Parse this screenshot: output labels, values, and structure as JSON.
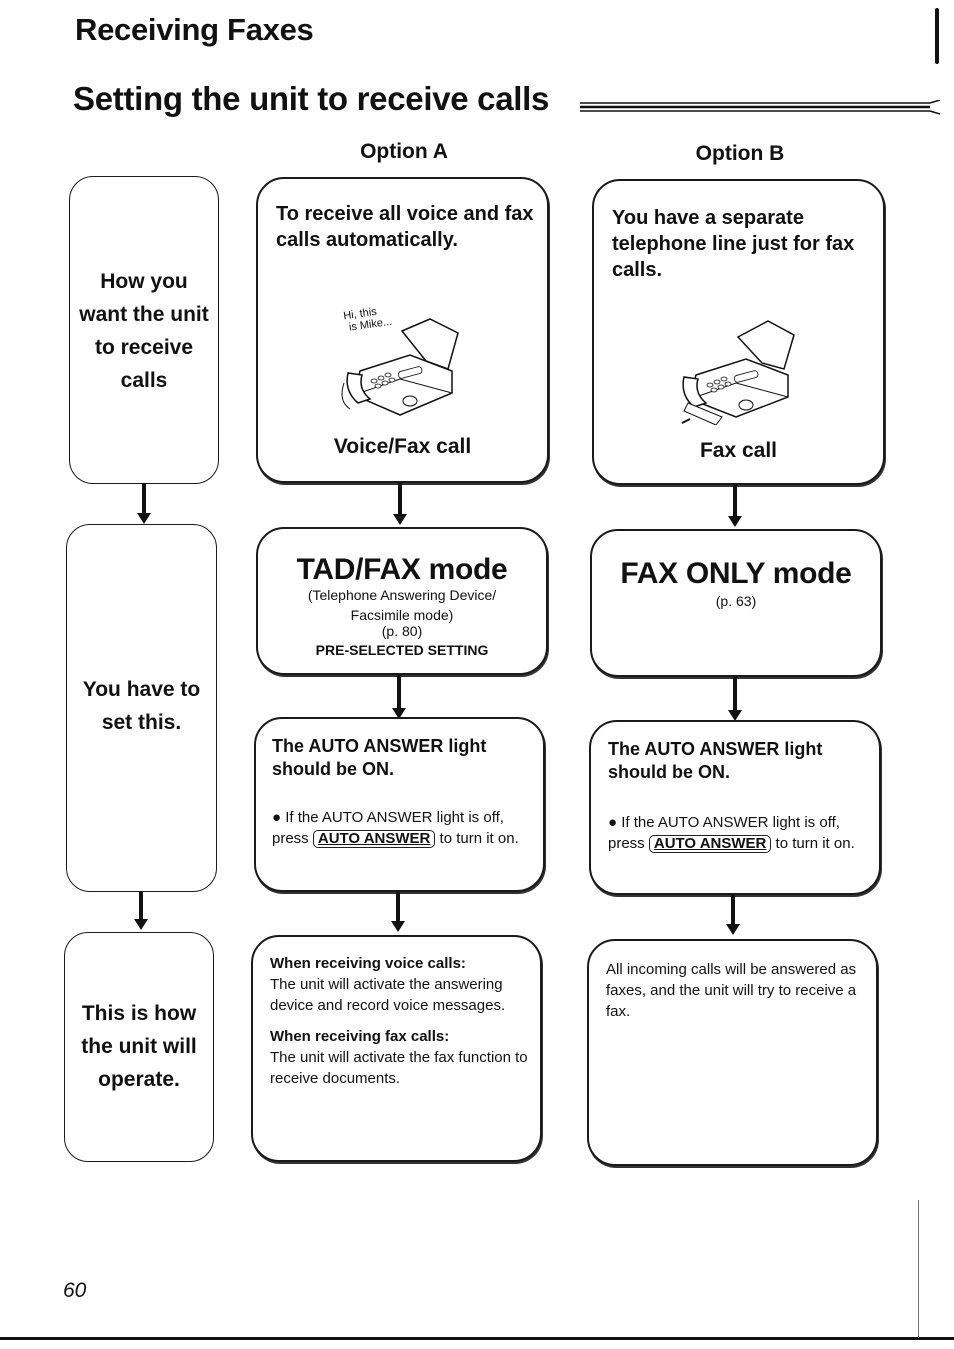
{
  "header": {
    "section_title": "Receiving Faxes",
    "page_title": "Setting the unit to receive calls"
  },
  "columns": {
    "option_a": "Option A",
    "option_b": "Option B"
  },
  "side_labels": {
    "how": "How you want the unit to receive calls",
    "how_lines": [
      "How you",
      "want the unit",
      "to receive",
      "calls"
    ],
    "set_lines": [
      "You have to",
      "set this."
    ],
    "operate_lines": [
      "This is how",
      "the unit will",
      "operate."
    ]
  },
  "option_a": {
    "situation": "To receive all voice and fax calls automatically.",
    "speech": [
      "Hi, this",
      "is Mike..."
    ],
    "caption": "Voice/Fax call",
    "mode_title": "TAD/FAX mode",
    "mode_sub": [
      "(Telephone Answering Device/",
      "Facsimile mode)"
    ],
    "mode_page": "(p. 80)",
    "mode_note": "PRE-SELECTED SETTING",
    "light_head": "The AUTO ANSWER light should be ON.",
    "light_bullet_pre": "If the AUTO ANSWER light is off, press",
    "light_key": "AUTO ANSWER",
    "light_bullet_post": "to turn it on.",
    "operate": [
      {
        "head": "When receiving voice calls:",
        "text": "The unit will activate the answering device and record voice messages."
      },
      {
        "head": "When receiving fax calls:",
        "text": "The unit will activate the fax function to receive documents."
      }
    ]
  },
  "option_b": {
    "situation": "You have a separate telephone line just for fax calls.",
    "caption": "Fax call",
    "mode_title": "FAX ONLY mode",
    "mode_page": "(p. 63)",
    "light_head": "The AUTO ANSWER light should be ON.",
    "light_bullet_pre": "If the AUTO ANSWER light is off, press",
    "light_key": "AUTO ANSWER",
    "light_bullet_post": "to turn it on.",
    "operate_text": "All incoming calls will be answered as faxes, and the unit will try to receive a fax."
  },
  "footer": {
    "page_number": "60"
  }
}
